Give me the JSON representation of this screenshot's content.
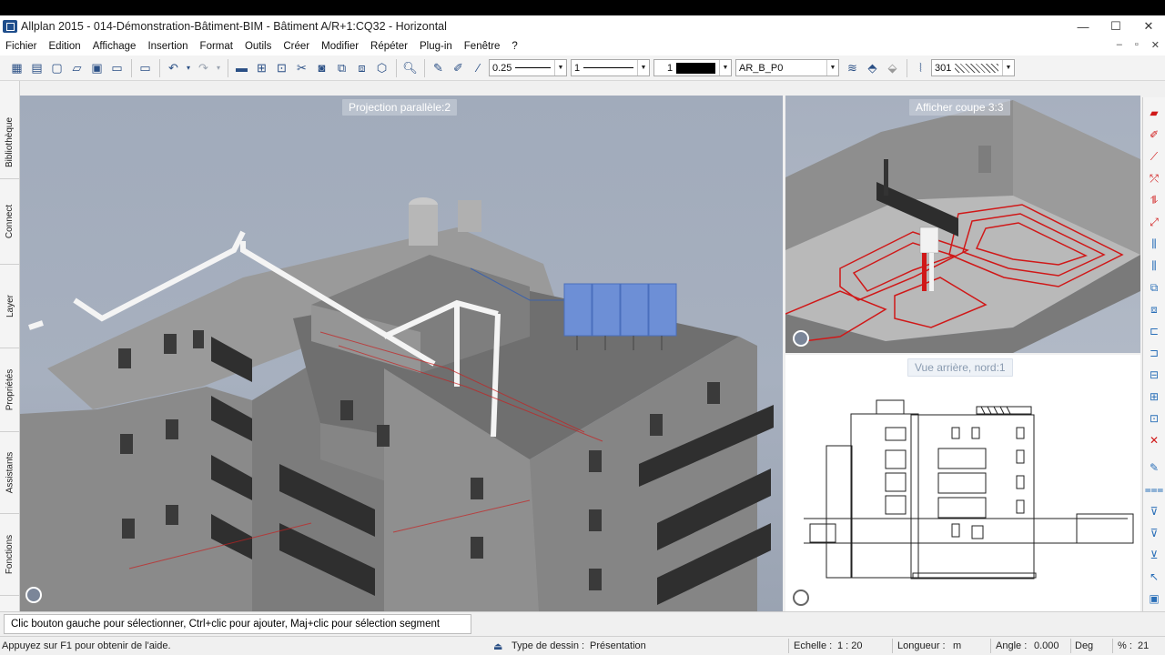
{
  "window": {
    "title": "Allplan 2015 - 014-Démonstration-Bâtiment-BIM - Bâtiment  A/R+1:CQ32 - Horizontal",
    "minimize": "—",
    "maximize": "☐",
    "close": "✕"
  },
  "menu": {
    "items": [
      "Fichier",
      "Edition",
      "Affichage",
      "Insertion",
      "Format",
      "Outils",
      "Créer",
      "Modifier",
      "Répéter",
      "Plug-in",
      "Fenêtre",
      "?"
    ],
    "mdi_minimize": "–",
    "mdi_restore": "▫",
    "mdi_close": "✕"
  },
  "toolbar": {
    "pen_thickness": "0.25",
    "line_type": "1",
    "color": "1",
    "layer": "AR_B_P0",
    "hatch_number": "301"
  },
  "left_tabs": [
    "Bibliothèque",
    "Connect",
    "Layer",
    "Propriétés",
    "Assistants",
    "Fonctions"
  ],
  "viewports": {
    "main_label": "Projection parallèle:2",
    "top_right_label": "Afficher coupe 3:3",
    "bottom_right_label": "Vue arrière, nord:1"
  },
  "prompt": {
    "text": "Clic bouton gauche pour sélectionner, Ctrl+clic pour ajouter, Maj+clic pour sélection segment"
  },
  "status": {
    "help": "Appuyez sur F1 pour obtenir de l'aide.",
    "drawing_type_label": "Type de dessin :",
    "drawing_type_value": "Présentation",
    "scale_label": "Echelle :",
    "scale_value": "1 : 20",
    "length_label": "Longueur :",
    "length_value": "m",
    "angle_label": "Angle :",
    "angle_value": "0.000",
    "angle_unit": "Deg",
    "percent_label": "% :",
    "percent_value": "21"
  },
  "colors": {
    "viewport_bg": "#a1abbb",
    "solar_panel": "#6d8fd6",
    "heating_pipes": "#d01818",
    "building": "#8b8b8b"
  }
}
